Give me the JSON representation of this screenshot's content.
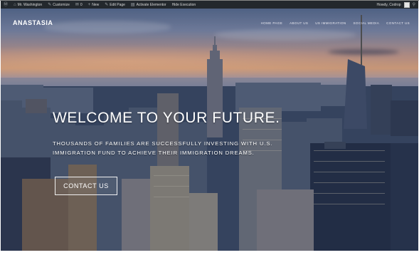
{
  "adminbar": {
    "items": [
      {
        "icon": "wordpress-icon",
        "glyph": "Ⓦ",
        "label": ""
      },
      {
        "icon": "home-icon",
        "glyph": "⌂",
        "label": "Mr. Washington"
      },
      {
        "icon": "brush-icon",
        "glyph": "✎",
        "label": "Customize"
      },
      {
        "icon": "comments-icon",
        "glyph": "✉",
        "label": "0"
      },
      {
        "icon": "plus-icon",
        "glyph": "+",
        "label": "New"
      },
      {
        "icon": "pencil-icon",
        "glyph": "✎",
        "label": "Edit Page"
      },
      {
        "icon": "menu-icon",
        "glyph": "▤",
        "label": "Activate Elementor"
      },
      {
        "icon": "",
        "glyph": "",
        "label": "Hide Execution"
      }
    ],
    "user": "Howdy, Codrop"
  },
  "site": {
    "title": "ANASTASIA",
    "nav": [
      "HOME PAGE",
      "ABOUT US",
      "US IMMIGRATION",
      "SOCIAL MEDIA",
      "CONTACT US"
    ]
  },
  "hero": {
    "title": "WELCOME TO YOUR FUTURE.",
    "subtitle": "THOUSANDS OF FAMILIES ARE SUCCESSFULLY INVESTING WITH U.S. IMMIGRATION FUND TO ACHIEVE THEIR IMMIGRATION DREAMS.",
    "cta_label": "CONTACT US"
  },
  "colors": {
    "adminbar_bg": "#23282d",
    "text_on_hero": "#ffffff"
  }
}
